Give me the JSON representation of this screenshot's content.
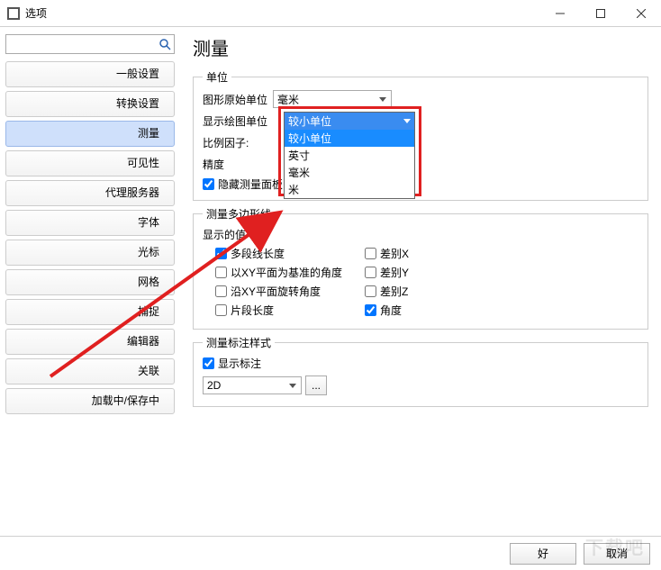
{
  "window": {
    "title": "选项"
  },
  "sidebar": {
    "search_placeholder": "",
    "items": [
      {
        "label": "一般设置"
      },
      {
        "label": "转换设置"
      },
      {
        "label": "测量",
        "selected": true
      },
      {
        "label": "可见性"
      },
      {
        "label": "代理服务器"
      },
      {
        "label": "字体"
      },
      {
        "label": "光标"
      },
      {
        "label": "网格"
      },
      {
        "label": "捕捉"
      },
      {
        "label": "编辑器"
      },
      {
        "label": "关联"
      },
      {
        "label": "加载中/保存中"
      }
    ]
  },
  "main": {
    "title": "测量",
    "units": {
      "legend": "单位",
      "drawing_label": "图形原始单位",
      "drawing_value": "毫米",
      "display_label": "显示绘图单位",
      "display_value": "较小单位",
      "display_options": [
        "较小单位",
        "英寸",
        "毫米",
        "米"
      ],
      "scale_label": "比例因子:",
      "scale_value": "",
      "precision_label": "精度",
      "precision_value": "",
      "hide_panel_label": "隐藏测量面板",
      "hide_panel_checked": true
    },
    "polyline": {
      "legend": "测量多边形线",
      "display_values_label": "显示的值",
      "left": [
        {
          "label": "多段线长度",
          "checked": true
        },
        {
          "label": "以XY平面为基准的角度",
          "checked": false
        },
        {
          "label": "沿XY平面旋转角度",
          "checked": false
        },
        {
          "label": "片段长度",
          "checked": false
        }
      ],
      "right": [
        {
          "label": "差别X",
          "checked": false
        },
        {
          "label": "差别Y",
          "checked": false
        },
        {
          "label": "差别Z",
          "checked": false
        },
        {
          "label": "角度",
          "checked": true
        }
      ]
    },
    "callout": {
      "legend": "测量标注样式",
      "show_label": "显示标注",
      "show_checked": true,
      "style_value": "2D",
      "more_button": "..."
    }
  },
  "footer": {
    "ok": "好",
    "cancel": "取消"
  },
  "watermark": "下载吧"
}
